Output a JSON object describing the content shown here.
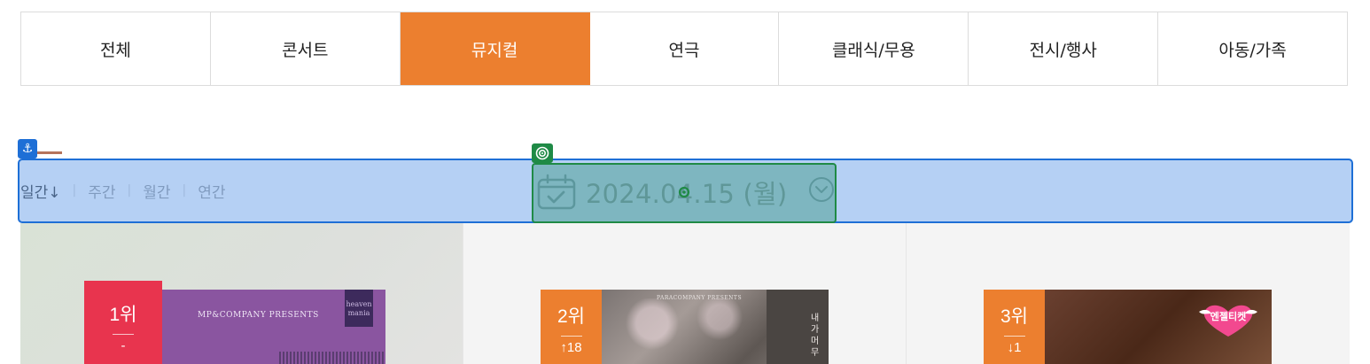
{
  "tabs": [
    {
      "label": "전체",
      "active": false
    },
    {
      "label": "콘서트",
      "active": false
    },
    {
      "label": "뮤지컬",
      "active": true
    },
    {
      "label": "연극",
      "active": false
    },
    {
      "label": "클래식/무용",
      "active": false
    },
    {
      "label": "전시/행사",
      "active": false
    },
    {
      "label": "아동/가족",
      "active": false
    }
  ],
  "periods": {
    "daily": "일간↓",
    "weekly": "주간",
    "monthly": "월간",
    "yearly": "연간",
    "separator": "|"
  },
  "date_picker": {
    "value": "2024.04.15 (월)",
    "calendar_icon": "calendar-check-icon",
    "toggle_icon": "chevron-down-circle-icon"
  },
  "overlay": {
    "anchor_icon": "⚓",
    "target_icon": "target-icon"
  },
  "rankings": [
    {
      "rank": "1위",
      "change": "-",
      "badge_color": "#e8344e",
      "poster": {
        "presenter": "MP&COMPANY PRESENTS",
        "logo_line1": "heaven",
        "logo_line2": "mania",
        "bg": "#8a55a0"
      }
    },
    {
      "rank": "2위",
      "change": "↑18",
      "badge_color": "#ec7f2f",
      "poster": {
        "presenter": "PARACOMPANY PRESENTS",
        "vertical_text": "내가 머무",
        "bg": "#6f6a66"
      }
    },
    {
      "rank": "3위",
      "change": "↓1",
      "badge_color": "#ec7f2f",
      "poster": {
        "heart_label": "엔젤티켓",
        "bg": "#5b3420"
      }
    }
  ],
  "colors": {
    "accent": "#ec7f2f",
    "rank1": "#e8344e",
    "selection_blue": "#1e6fd6",
    "selection_green": "#1f8a46"
  }
}
